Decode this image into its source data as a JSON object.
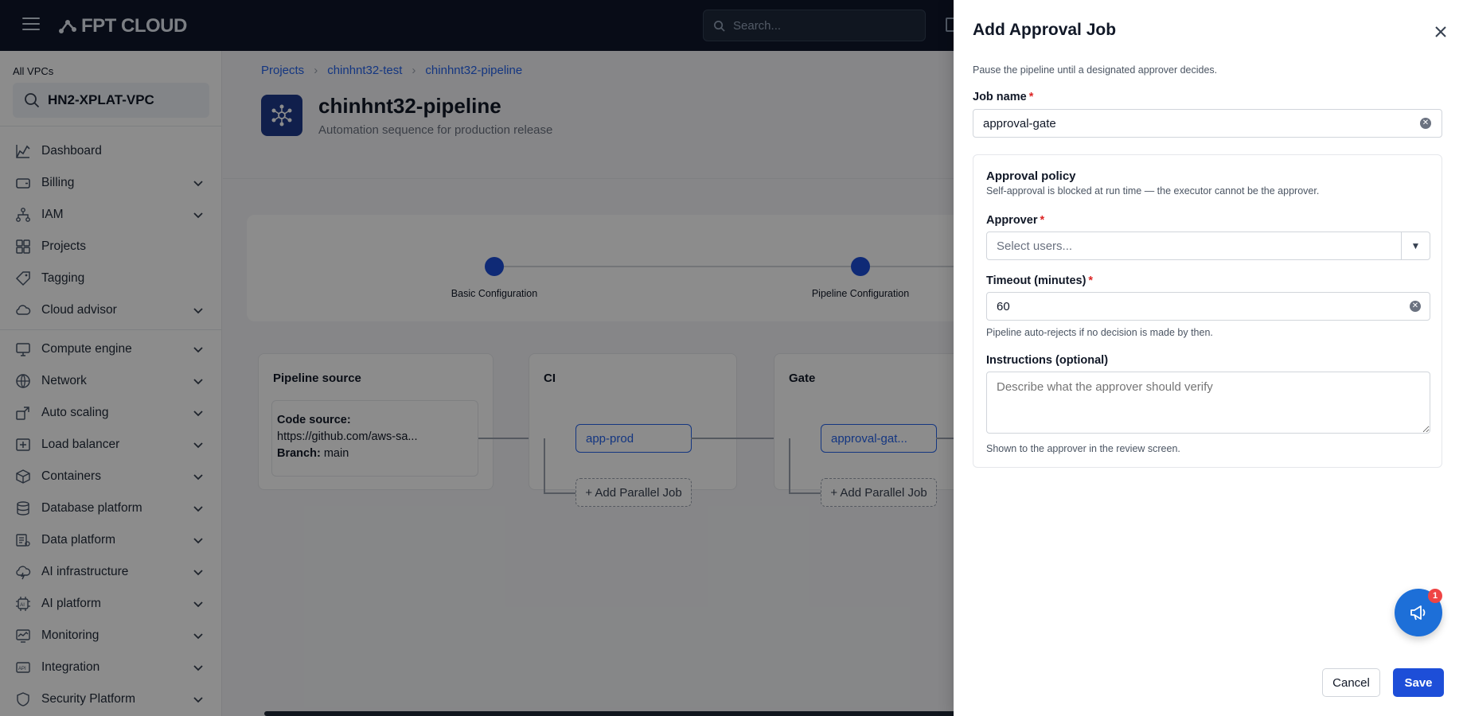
{
  "topbar": {
    "logo_text": "FPT CLOUD",
    "search_placeholder": "Search..."
  },
  "sidebar": {
    "vpc_label": "All VPCs",
    "vpc_name": "HN2-XPLAT-VPC",
    "items": [
      {
        "label": "Dashboard",
        "icon": "chart-icon",
        "expandable": false
      },
      {
        "label": "Billing",
        "icon": "wallet-icon",
        "expandable": true
      },
      {
        "label": "IAM",
        "icon": "org-icon",
        "expandable": true
      },
      {
        "label": "Projects",
        "icon": "grid-icon",
        "expandable": false
      },
      {
        "label": "Tagging",
        "icon": "tag-icon",
        "expandable": false
      },
      {
        "label": "Cloud advisor",
        "icon": "cloud-icon",
        "expandable": true
      },
      {
        "label": "Compute engine",
        "icon": "monitor-icon",
        "expandable": true
      },
      {
        "label": "Network",
        "icon": "globe-icon",
        "expandable": true
      },
      {
        "label": "Auto scaling",
        "icon": "scale-icon",
        "expandable": true
      },
      {
        "label": "Load balancer",
        "icon": "balance-icon",
        "expandable": true
      },
      {
        "label": "Containers",
        "icon": "box-icon",
        "expandable": true
      },
      {
        "label": "Database platform",
        "icon": "database-icon",
        "expandable": true
      },
      {
        "label": "Data platform",
        "icon": "data-icon",
        "expandable": true
      },
      {
        "label": "AI infrastructure",
        "icon": "cloud-bolt-icon",
        "expandable": true
      },
      {
        "label": "AI platform",
        "icon": "ai-icon",
        "expandable": true
      },
      {
        "label": "Monitoring",
        "icon": "monitoring-icon",
        "expandable": true
      },
      {
        "label": "Integration",
        "icon": "api-icon",
        "expandable": true
      },
      {
        "label": "Security Platform",
        "icon": "shield-icon",
        "expandable": true
      }
    ]
  },
  "breadcrumb": [
    "Projects",
    "chinhnt32-test",
    "chinhnt32-pipeline"
  ],
  "page": {
    "title": "chinhnt32-pipeline",
    "subtitle": "Automation sequence for production release"
  },
  "stepper": {
    "steps": [
      "Basic Configuration",
      "Pipeline Configuration"
    ]
  },
  "pipeline": {
    "source": {
      "title": "Pipeline source",
      "code_source_label": "Code source:",
      "code_source_value": "https://github.com/aws-sa...",
      "branch_label": "Branch:",
      "branch_value": "main"
    },
    "stages": [
      {
        "title": "CI",
        "job": "app-prod",
        "parallel_label": "+ Add Parallel Job"
      },
      {
        "title": "Gate",
        "job": "approval-gat...",
        "parallel_label": "+ Add Parallel Job"
      }
    ]
  },
  "drawer": {
    "title": "Add Approval Job",
    "description": "Pause the pipeline until a designated approver decides.",
    "job_name_label": "Job name",
    "job_name_value": "approval-gate",
    "policy": {
      "title": "Approval policy",
      "subtitle": "Self-approval is blocked at run time — the executor cannot be the approver.",
      "approver_label": "Approver",
      "approver_placeholder": "Select users...",
      "timeout_label": "Timeout (minutes)",
      "timeout_value": "60",
      "timeout_help": "Pipeline auto-rejects if no decision is made by then.",
      "instructions_label": "Instructions (optional)",
      "instructions_placeholder": "Describe what the approver should verify",
      "instructions_help": "Shown to the approver in the review screen."
    },
    "cancel_label": "Cancel",
    "save_label": "Save"
  },
  "fab": {
    "badge": "1"
  },
  "colors": {
    "accent": "#1d4ed8",
    "topbar": "#0f172a",
    "required": "#dc2626"
  }
}
